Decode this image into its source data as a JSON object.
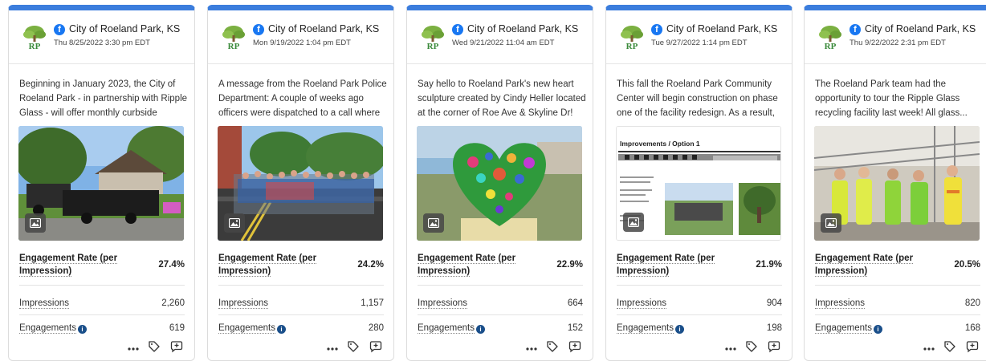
{
  "cards": [
    {
      "page_name": "City of Roeland Park, KS",
      "date": "Thu 8/25/2022 3:30 pm EDT",
      "text": "Beginning in January 2023, the City of Roeland Park - in partnership with Ripple Glass - will offer monthly curbside glass...",
      "metric_label": "Engagement Rate (per Impression)",
      "metric_value": "27.4%",
      "impressions_label": "Impressions",
      "impressions": "2,260",
      "engagements_label": "Engagements",
      "engagements": "619"
    },
    {
      "page_name": "City of Roeland Park, KS",
      "date": "Mon 9/19/2022 1:04 pm EDT",
      "text": "A message from the Roeland Park Police Department: A couple of weeks ago officers were dispatched to a call where ...",
      "metric_label": "Engagement Rate (per Impression)",
      "metric_value": "24.2%",
      "impressions_label": "Impressions",
      "impressions": "1,157",
      "engagements_label": "Engagements",
      "engagements": "280"
    },
    {
      "page_name": "City of Roeland Park, KS",
      "date": "Wed 9/21/2022 11:04 am EDT",
      "text": "Say hello to Roeland Park's new heart sculpture created by Cindy Heller located at the corner of Roe Ave & Skyline Dr! Th...",
      "metric_label": "Engagement Rate (per Impression)",
      "metric_value": "22.9%",
      "impressions_label": "Impressions",
      "impressions": "664",
      "engagements_label": "Engagements",
      "engagements": "152"
    },
    {
      "page_name": "City of Roeland Park, KS",
      "date": "Tue 9/27/2022 1:14 pm EDT",
      "text": "This fall the Roeland Park Community Center will begin construction on phase one of the facility redesign. As a result, al...",
      "image_heading": "Improvements / Option 1",
      "metric_label": "Engagement Rate (per Impression)",
      "metric_value": "21.9%",
      "impressions_label": "Impressions",
      "impressions": "904",
      "engagements_label": "Engagements",
      "engagements": "198"
    },
    {
      "page_name": "City of Roeland Park, KS",
      "date": "Thu 9/22/2022 2:31 pm EDT",
      "text": "The Roeland Park team had the opportunity to tour the Ripple Glass recycling facility last week! All glass...",
      "metric_label": "Engagement Rate (per Impression)",
      "metric_value": "20.5%",
      "impressions_label": "Impressions",
      "impressions": "820",
      "engagements_label": "Engagements",
      "engagements": "168"
    }
  ],
  "logo_text": "RP",
  "icons": {
    "network": "facebook-icon",
    "image_badge": "image-icon",
    "info": "info-icon",
    "more": "more-icon",
    "tag": "tag-icon",
    "comment": "comment-icon"
  },
  "colors": {
    "accent_top": "#3b7ddd",
    "facebook": "#1877f2",
    "info": "#1a4f8a"
  }
}
